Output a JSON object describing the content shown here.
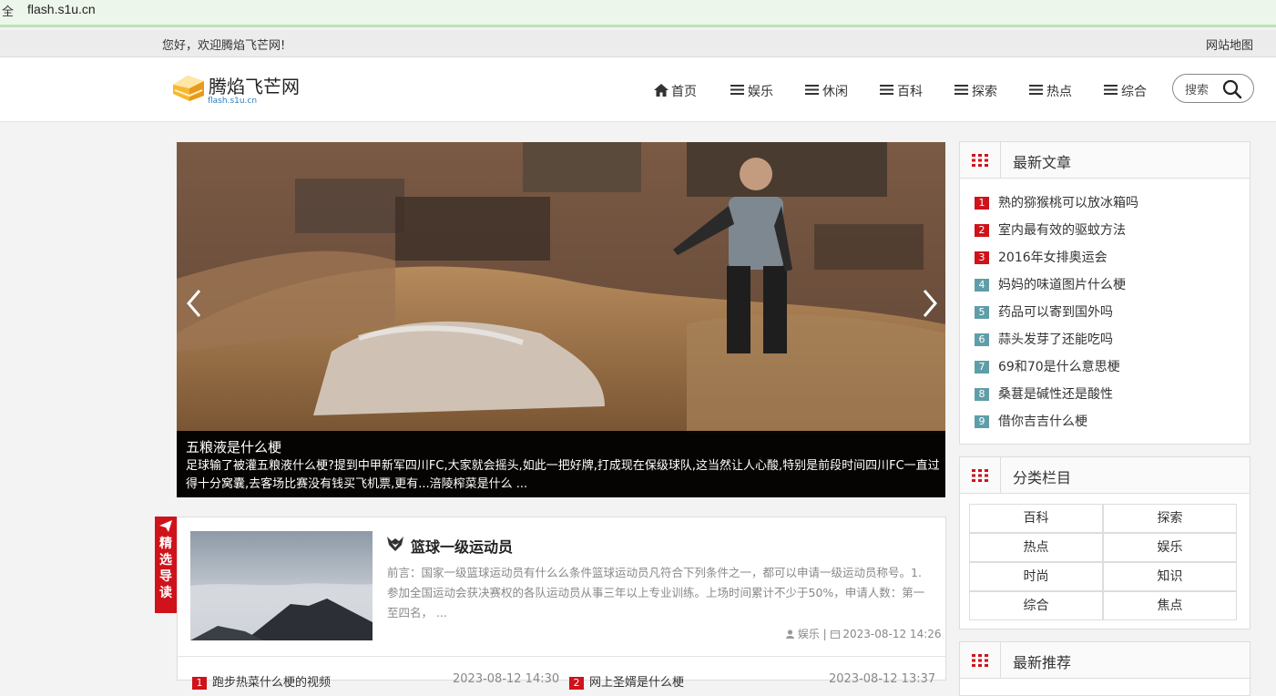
{
  "browser": {
    "prefix": "全",
    "url": "flash.s1u.cn"
  },
  "topbar": {
    "welcome": "您好，欢迎腾焰飞芒网!",
    "sitemap": "网站地图"
  },
  "logo": {
    "name": "腾焰飞芒网",
    "sub": "flash.s1u.cn"
  },
  "nav": [
    {
      "label": "首页",
      "icon": "home-icon"
    },
    {
      "label": "娱乐",
      "icon": "list-icon"
    },
    {
      "label": "休闲",
      "icon": "list-icon"
    },
    {
      "label": "百科",
      "icon": "list-icon"
    },
    {
      "label": "探索",
      "icon": "list-icon"
    },
    {
      "label": "热点",
      "icon": "list-icon"
    },
    {
      "label": "综合",
      "icon": "list-icon"
    }
  ],
  "search": {
    "placeholder": "搜索"
  },
  "slider": {
    "title": "五粮液是什么梗",
    "desc": "足球输了被灌五粮液什么梗?提到中甲新军四川FC,大家就会摇头,如此一把好牌,打成现在保级球队,这当然让人心酸,特别是前段时间四川FC一直过得十分窝囊,去客场比赛没有钱买飞机票,更有...涪陵榨菜是什么 ..."
  },
  "latest": {
    "title": "最新文章",
    "items": [
      {
        "num": "1",
        "label": "熟的猕猴桃可以放冰箱吗",
        "color": "#d0121b"
      },
      {
        "num": "2",
        "label": "室内最有效的驱蚊方法",
        "color": "#d0121b"
      },
      {
        "num": "3",
        "label": "2016年女排奥运会",
        "color": "#d0121b"
      },
      {
        "num": "4",
        "label": "妈妈的味道图片什么梗",
        "color": "#5f9ea8"
      },
      {
        "num": "5",
        "label": "药品可以寄到国外吗",
        "color": "#5f9ea8"
      },
      {
        "num": "6",
        "label": "蒜头发芽了还能吃吗",
        "color": "#5f9ea8"
      },
      {
        "num": "7",
        "label": "69和70是什么意思梗",
        "color": "#5f9ea8"
      },
      {
        "num": "8",
        "label": "桑葚是碱性还是酸性",
        "color": "#5f9ea8"
      },
      {
        "num": "9",
        "label": "借你吉吉什么梗",
        "color": "#5f9ea8"
      }
    ]
  },
  "categories": {
    "title": "分类栏目",
    "items": [
      "百科",
      "探索",
      "热点",
      "娱乐",
      "时尚",
      "知识",
      "综合",
      "焦点"
    ]
  },
  "recommend": {
    "title": "最新推荐"
  },
  "ribbon": {
    "label": "精选导读"
  },
  "feature": {
    "title": "篮球一级运动员",
    "desc": "前言：国家一级篮球运动员有什么么条件篮球运动员凡符合下列条件之一，都可以申请一级运动员称号。1.参加全国运动会获决赛权的各队运动员从事三年以上专业训练。上场时间累计不少于50%，申请人数：第一至四名，  ...",
    "category": "娱乐",
    "separator": "|",
    "date": "2023-08-12 14:26"
  },
  "list": [
    {
      "num": "1",
      "label": "跑步热菜什么梗的视频",
      "date": "2023-08-12 14:30"
    },
    {
      "num": "2",
      "label": "网上圣婿是什么梗",
      "date": "2023-08-12 13:37"
    }
  ]
}
